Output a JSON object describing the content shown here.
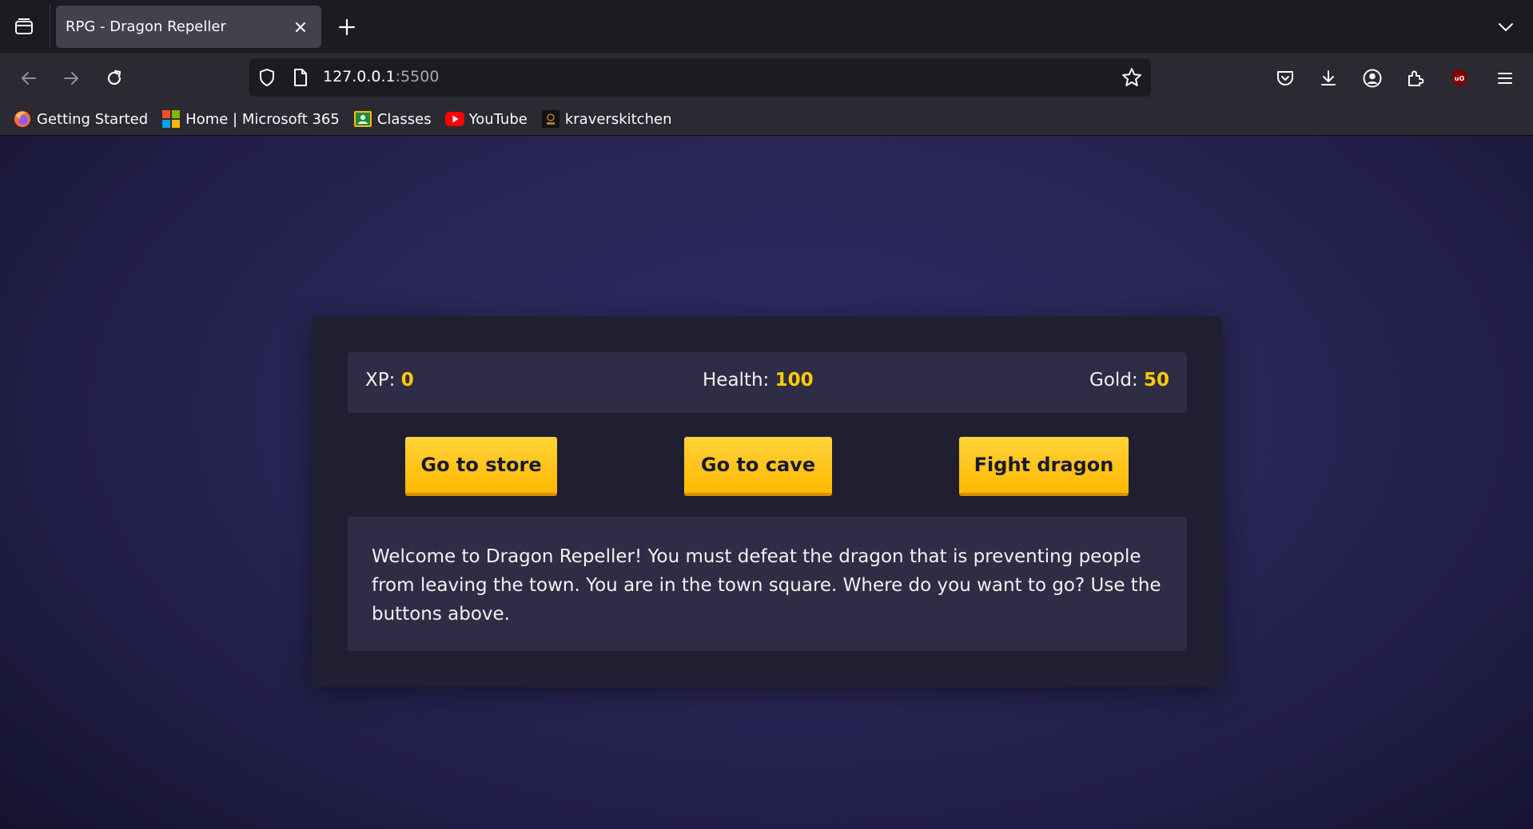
{
  "browser": {
    "tab_title": "RPG - Dragon Repeller",
    "url_host": "127.0.0.1",
    "url_port": ":5500",
    "bookmarks": [
      {
        "label": "Getting Started",
        "icon": "firefox-icon"
      },
      {
        "label": "Home | Microsoft 365",
        "icon": "microsoft-icon"
      },
      {
        "label": "Classes",
        "icon": "classes-icon"
      },
      {
        "label": "YouTube",
        "icon": "youtube-icon"
      },
      {
        "label": "kraverskitchen",
        "icon": "kraverskitchen-icon"
      }
    ]
  },
  "game": {
    "stats": {
      "xp_label": "XP: ",
      "xp_value": "0",
      "health_label": "Health: ",
      "health_value": "100",
      "gold_label": "Gold: ",
      "gold_value": "50"
    },
    "buttons": {
      "store": "Go to store",
      "cave": "Go to cave",
      "dragon": "Fight dragon"
    },
    "text": "Welcome to Dragon Repeller! You must defeat the dragon that is preventing people from leaving the town. You are in the town square. Where do you want to go? Use the buttons above."
  },
  "colors": {
    "accent": "#ffcc00",
    "button": "#ffc107",
    "panel": "#201f31",
    "background": "#2a2657"
  }
}
